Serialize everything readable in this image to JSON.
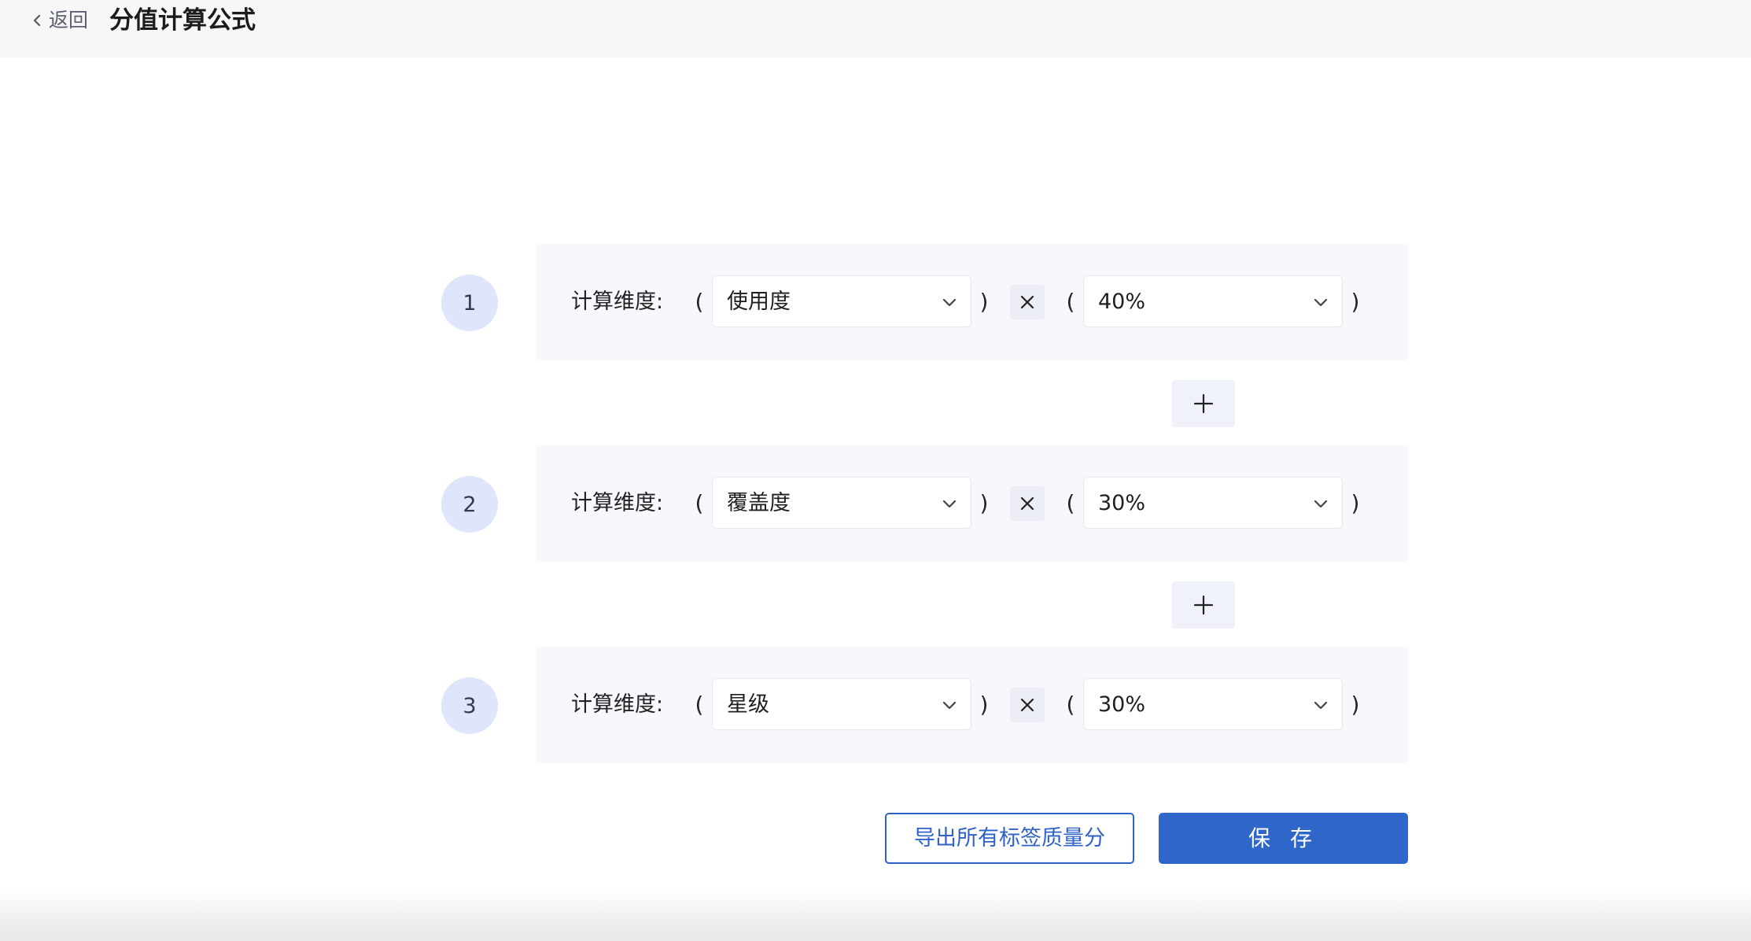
{
  "header": {
    "back_label": "返回",
    "title": "分值计算公式"
  },
  "formula": {
    "dimension_label": "计算维度:",
    "open_paren": "(",
    "close_paren": ")",
    "rows": [
      {
        "index": "1",
        "dimension": "使用度",
        "weight": "40%"
      },
      {
        "index": "2",
        "dimension": "覆盖度",
        "weight": "30%"
      },
      {
        "index": "3",
        "dimension": "星级",
        "weight": "30%"
      }
    ]
  },
  "actions": {
    "export_label": "导出所有标签质量分",
    "save_label": "保 存"
  },
  "colors": {
    "primary": "#2f66c9",
    "step_circle": "#dfe6fb",
    "row_panel": "#f7f8fc"
  },
  "icons": {
    "back": "chevron-left-icon",
    "dropdown": "chevron-down-icon",
    "multiply": "times-icon",
    "add": "plus-icon"
  }
}
